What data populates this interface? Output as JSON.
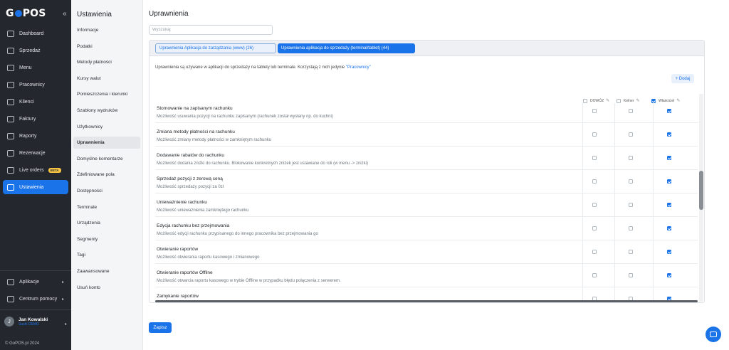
{
  "brand": {
    "logo_pre": "G",
    "logo_post": "POS"
  },
  "nav": {
    "collapse": "«",
    "items": [
      {
        "label": "Dashboard",
        "icon": "dashboard-icon"
      },
      {
        "label": "Sprzedaż",
        "icon": "chart-icon"
      },
      {
        "label": "Menu",
        "icon": "menu-icon"
      },
      {
        "label": "Pracownicy",
        "icon": "id-card-icon"
      },
      {
        "label": "Klienci",
        "icon": "users-icon"
      },
      {
        "label": "Faktury",
        "icon": "invoice-icon"
      },
      {
        "label": "Raporty",
        "icon": "report-icon"
      },
      {
        "label": "Rezerwacje",
        "icon": "calendar-icon"
      },
      {
        "label": "Live orders",
        "icon": "live-icon",
        "badge": "BETA"
      },
      {
        "label": "Ustawienia",
        "icon": "settings-icon",
        "active": true
      }
    ],
    "bottom": [
      {
        "label": "Aplikacje",
        "icon": "apps-icon"
      },
      {
        "label": "Centrum pomocy",
        "icon": "help-icon"
      }
    ],
    "user": {
      "initial": "J",
      "name": "Jan Kowalski",
      "org": "Sushi DEMO"
    },
    "copyright": "© GoPOS.pl 2024"
  },
  "settings_menu": {
    "title": "Ustawienia",
    "items": [
      "Informacje",
      "Podatki",
      "Metody płatności",
      "Kursy walut",
      "Pomieszczenia i kierunki",
      "Szablony wydruków",
      "Użytkownicy",
      "Uprawnienia",
      "Domyślne komentarze",
      "Zdefiniowane pola",
      "Dostępności",
      "Terminale",
      "Urządzenia",
      "Segmenty",
      "Tagi",
      "Zaawansowane",
      "Usuń konto"
    ],
    "active_index": 7
  },
  "page": {
    "title": "Uprawnienia",
    "search_placeholder": "Wyszukaj",
    "tabs": [
      "Uprawnienia Aplikacja do zarządzania (www) (26)",
      "Uprawnienia aplikacja do sprzedaży (terminal/tablet) (44)"
    ],
    "info_text": "Uprawnienia są używane w aplikacji do sprzedaży na tablety lub terminale. Korzystają z nich jedynie ",
    "info_link": "\"Pracownicy\"",
    "add_label": "+ Dodaj",
    "save_label": "Zapisz"
  },
  "roles": [
    {
      "label": "DOWÓZ",
      "checked": false
    },
    {
      "label": "Kelner",
      "checked": false
    },
    {
      "label": "Właściciel",
      "checked": true
    }
  ],
  "permissions": [
    {
      "name": "Stornowanie na zapisanym rachunku",
      "desc": "Możliwość usuwania pozycji na rachunku zapisanym (rachunek został wysłany np. do kuchni)",
      "roles": [
        false,
        false,
        true
      ]
    },
    {
      "name": "Zmiana metody płatności na rachunku",
      "desc": "Możliwość zmiany metody płatności w zamkniętym rachunku",
      "roles": [
        false,
        false,
        true
      ]
    },
    {
      "name": "Dodawanie rabatów do rachunku",
      "desc": "Możliwość dodania zniżki do rachunku. Blokowanie konkretnych zniżek jest ustawiane do roli (w menu -> zniżki)",
      "roles": [
        false,
        false,
        true
      ]
    },
    {
      "name": "Sprzedaż pozycji z zerową ceną",
      "desc": "Możliwość sprzedaży pozycji za 0zł",
      "roles": [
        false,
        false,
        true
      ]
    },
    {
      "name": "Unieważnienie rachunku",
      "desc": "Możliwość unieważnienia zamkniętego rachunku",
      "roles": [
        false,
        false,
        true
      ]
    },
    {
      "name": "Edycja rachunku bez przejmowania",
      "desc": "Możliwość edycji rachunku przypisanego do innego pracownika bez przejmowania go",
      "roles": [
        false,
        false,
        true
      ]
    },
    {
      "name": "Otwieranie raportów",
      "desc": "Możliwość otwierania raportu kasowego i zmianowego",
      "roles": [
        false,
        false,
        true
      ]
    },
    {
      "name": "Otwieranie raportów Offline",
      "desc": "Możliwość otwarcia raportu kasowego w trybie Offline w przypadku błędu połączenia z serwerem.",
      "roles": [
        false,
        false,
        true
      ]
    },
    {
      "name": "Zamykanie raportów",
      "desc": "",
      "roles": [
        false,
        false,
        true
      ]
    }
  ]
}
